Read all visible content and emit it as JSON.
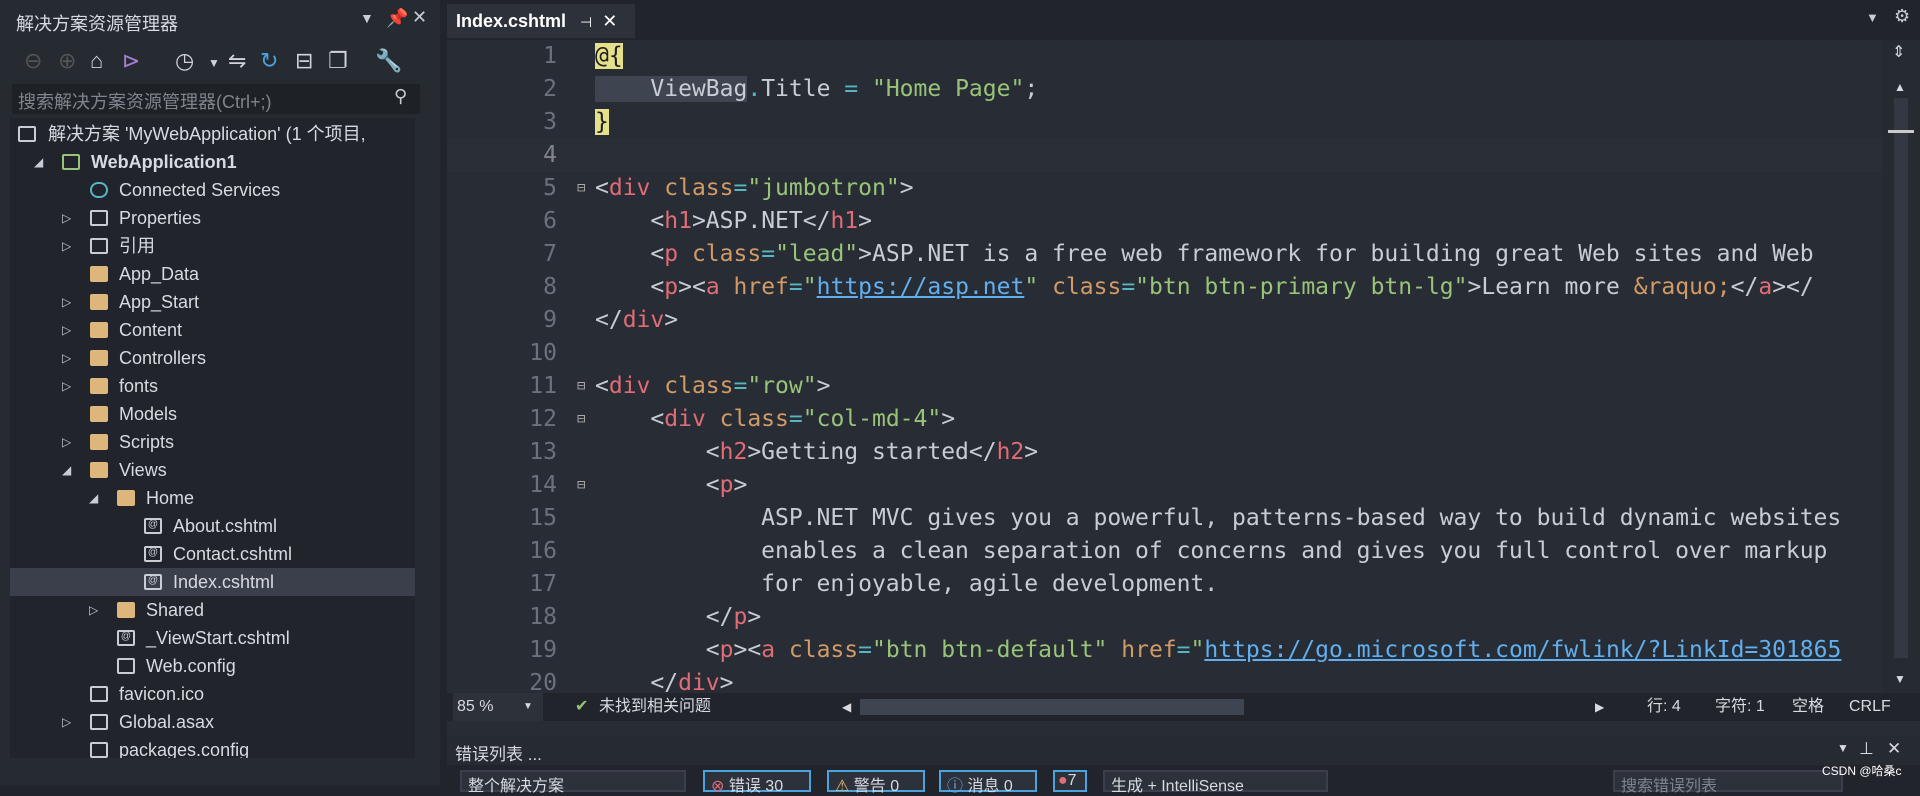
{
  "explorer": {
    "title": "解决方案资源管理器",
    "search_placeholder": "搜索解决方案资源管理器(Ctrl+;)",
    "items": [
      {
        "label": "解决方案 'MyWebApplication' (1 个项目,",
        "level": 0,
        "arrow": "",
        "icon": "solution-icon"
      },
      {
        "label": "WebApplication1",
        "level": 0,
        "arrow": "expanded",
        "icon": "web-project-icon",
        "bold": true
      },
      {
        "label": "Connected Services",
        "level": 1,
        "arrow": "",
        "icon": "cloud-icon"
      },
      {
        "label": "Properties",
        "level": 1,
        "arrow": "collapsed",
        "icon": "wrench-icon"
      },
      {
        "label": "引用",
        "level": 1,
        "arrow": "collapsed",
        "icon": "references-icon"
      },
      {
        "label": "App_Data",
        "level": 1,
        "arrow": "",
        "icon": "folder-icon"
      },
      {
        "label": "App_Start",
        "level": 1,
        "arrow": "collapsed",
        "icon": "folder-icon"
      },
      {
        "label": "Content",
        "level": 1,
        "arrow": "collapsed",
        "icon": "folder-icon"
      },
      {
        "label": "Controllers",
        "level": 1,
        "arrow": "collapsed",
        "icon": "folder-icon"
      },
      {
        "label": "fonts",
        "level": 1,
        "arrow": "collapsed",
        "icon": "folder-icon"
      },
      {
        "label": "Models",
        "level": 1,
        "arrow": "",
        "icon": "folder-icon"
      },
      {
        "label": "Scripts",
        "level": 1,
        "arrow": "collapsed",
        "icon": "folder-icon"
      },
      {
        "label": "Views",
        "level": 1,
        "arrow": "expanded",
        "icon": "folder-icon"
      },
      {
        "label": "Home",
        "level": 2,
        "arrow": "expanded",
        "icon": "folder-icon"
      },
      {
        "label": "About.cshtml",
        "level": 3,
        "arrow": "",
        "icon": "razor-file-icon"
      },
      {
        "label": "Contact.cshtml",
        "level": 3,
        "arrow": "",
        "icon": "razor-file-icon"
      },
      {
        "label": "Index.cshtml",
        "level": 3,
        "arrow": "",
        "icon": "razor-file-icon",
        "selected": true
      },
      {
        "label": "Shared",
        "level": 2,
        "arrow": "collapsed",
        "icon": "folder-icon"
      },
      {
        "label": "_ViewStart.cshtml",
        "level": 2,
        "arrow": "",
        "icon": "razor-file-icon"
      },
      {
        "label": "Web.config",
        "level": 2,
        "arrow": "",
        "icon": "config-file-icon"
      },
      {
        "label": "favicon.ico",
        "level": 1,
        "arrow": "",
        "icon": "image-file-icon"
      },
      {
        "label": "Global.asax",
        "level": 1,
        "arrow": "collapsed",
        "icon": "asax-file-icon"
      },
      {
        "label": "packages.config",
        "level": 1,
        "arrow": "",
        "icon": "config-file-icon"
      }
    ]
  },
  "editor": {
    "tab_label": "Index.cshtml",
    "lines": [
      [
        [
          "raz",
          "@{"
        ]
      ],
      [
        [
          "txt",
          "    ViewBag"
        ],
        [
          "eq",
          "."
        ],
        [
          "txt",
          "Title "
        ],
        [
          "eq",
          "="
        ],
        [
          "str",
          " \"Home Page\""
        ],
        [
          "txt",
          ";"
        ]
      ],
      [
        [
          "raz",
          "}"
        ]
      ],
      [],
      [
        [
          "txt",
          "<"
        ],
        [
          "tag",
          "div"
        ],
        [
          "attr",
          " class"
        ],
        [
          "eq",
          "="
        ],
        [
          "str",
          "\"jumbotron\""
        ],
        [
          "txt",
          ">"
        ]
      ],
      [
        [
          "txt",
          "    <"
        ],
        [
          "tag",
          "h1"
        ],
        [
          "txt",
          ">ASP.NET</"
        ],
        [
          "tag",
          "h1"
        ],
        [
          "txt",
          ">"
        ]
      ],
      [
        [
          "txt",
          "    <"
        ],
        [
          "tag",
          "p"
        ],
        [
          "attr",
          " class"
        ],
        [
          "eq",
          "="
        ],
        [
          "str",
          "\"lead\""
        ],
        [
          "txt",
          ">ASP.NET is a free web framework for building great Web sites and Web"
        ]
      ],
      [
        [
          "txt",
          "    <"
        ],
        [
          "tag",
          "p"
        ],
        [
          "txt",
          "><"
        ],
        [
          "tag",
          "a"
        ],
        [
          "attr",
          " href"
        ],
        [
          "eq",
          "="
        ],
        [
          "str",
          "\""
        ],
        [
          "link",
          "https://asp.net"
        ],
        [
          "str",
          "\""
        ],
        [
          "attr",
          " class"
        ],
        [
          "eq",
          "="
        ],
        [
          "str",
          "\"btn btn-primary btn-lg\""
        ],
        [
          "txt",
          ">Learn more "
        ],
        [
          "attr",
          "&raquo;"
        ],
        [
          "txt",
          "</"
        ],
        [
          "tag",
          "a"
        ],
        [
          "txt",
          "></"
        ]
      ],
      [
        [
          "txt",
          "</"
        ],
        [
          "tag",
          "div"
        ],
        [
          "txt",
          ">"
        ]
      ],
      [],
      [
        [
          "txt",
          "<"
        ],
        [
          "tag",
          "div"
        ],
        [
          "attr",
          " class"
        ],
        [
          "eq",
          "="
        ],
        [
          "str",
          "\"row\""
        ],
        [
          "txt",
          ">"
        ]
      ],
      [
        [
          "txt",
          "    <"
        ],
        [
          "tag",
          "div"
        ],
        [
          "attr",
          " class"
        ],
        [
          "eq",
          "="
        ],
        [
          "str",
          "\"col-md-4\""
        ],
        [
          "txt",
          ">"
        ]
      ],
      [
        [
          "txt",
          "        <"
        ],
        [
          "tag",
          "h2"
        ],
        [
          "txt",
          ">Getting started</"
        ],
        [
          "tag",
          "h2"
        ],
        [
          "txt",
          ">"
        ]
      ],
      [
        [
          "txt",
          "        <"
        ],
        [
          "tag",
          "p"
        ],
        [
          "txt",
          ">"
        ]
      ],
      [
        [
          "txt",
          "            ASP.NET MVC gives you a powerful, patterns-based way to build dynamic websites"
        ]
      ],
      [
        [
          "txt",
          "            enables a clean separation of concerns and gives you full control over markup"
        ]
      ],
      [
        [
          "txt",
          "            for enjoyable, agile development."
        ]
      ],
      [
        [
          "txt",
          "        </"
        ],
        [
          "tag",
          "p"
        ],
        [
          "txt",
          ">"
        ]
      ],
      [
        [
          "txt",
          "        <"
        ],
        [
          "tag",
          "p"
        ],
        [
          "txt",
          "><"
        ],
        [
          "tag",
          "a"
        ],
        [
          "attr",
          " class"
        ],
        [
          "eq",
          "="
        ],
        [
          "str",
          "\"btn btn-default\""
        ],
        [
          "attr",
          " href"
        ],
        [
          "eq",
          "="
        ],
        [
          "str",
          "\""
        ],
        [
          "link",
          "https://go.microsoft.com/fwlink/?LinkId=301865"
        ]
      ],
      [
        [
          "txt",
          "    </"
        ],
        [
          "tag",
          "div"
        ],
        [
          "txt",
          ">"
        ]
      ]
    ]
  },
  "status": {
    "zoom": "85 %",
    "issues": "未找到相关问题",
    "line": "行: 4",
    "char": "字符: 1",
    "spaces": "空格",
    "eol": "CRLF"
  },
  "error_list": {
    "title": "错误列表 ...",
    "scope": "整个解决方案",
    "errors": "错误 30",
    "warnings": "警告 0",
    "messages": "消息 0",
    "filter": "7",
    "source": "生成 + IntelliSense",
    "search_placeholder": "搜索错误列表"
  },
  "watermark": "CSDN @哈桑c"
}
